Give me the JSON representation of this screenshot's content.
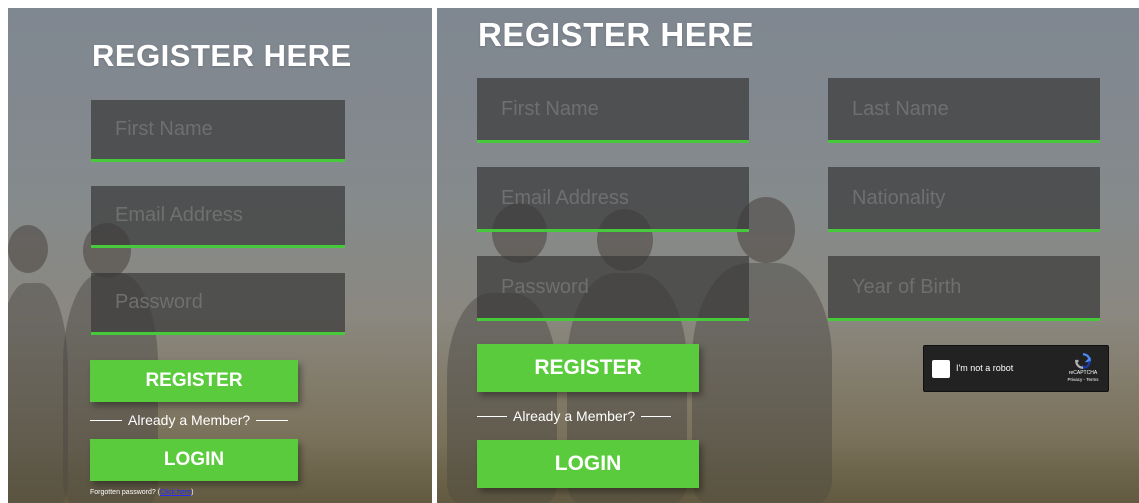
{
  "left_form": {
    "title": "REGISTER HERE",
    "fields": {
      "first_name": "First Name",
      "email": "Email Address",
      "password": "Password"
    },
    "register_label": "REGISTER",
    "divider_text": "Already a Member?",
    "login_label": "LOGIN",
    "forgot_text": "Forgotten password?",
    "forgot_link": "Click here"
  },
  "right_form": {
    "title": "REGISTER HERE",
    "fields": {
      "first_name": "First Name",
      "last_name": "Last Name",
      "email": "Email Address",
      "nationality": "Nationality",
      "password": "Password",
      "year_of_birth": "Year of Birth"
    },
    "register_label": "REGISTER",
    "divider_text": "Already a Member?",
    "login_label": "LOGIN",
    "recaptcha": {
      "label": "I'm not a robot",
      "brand": "reCAPTCHA",
      "links": "Privacy - Terms"
    }
  },
  "colors": {
    "accent": "#5acb3c",
    "field_underline": "#46c93a",
    "field_bg": "#3a3a3a",
    "title": "#ffffff"
  },
  "icons": [
    "recaptcha-logo-icon"
  ]
}
